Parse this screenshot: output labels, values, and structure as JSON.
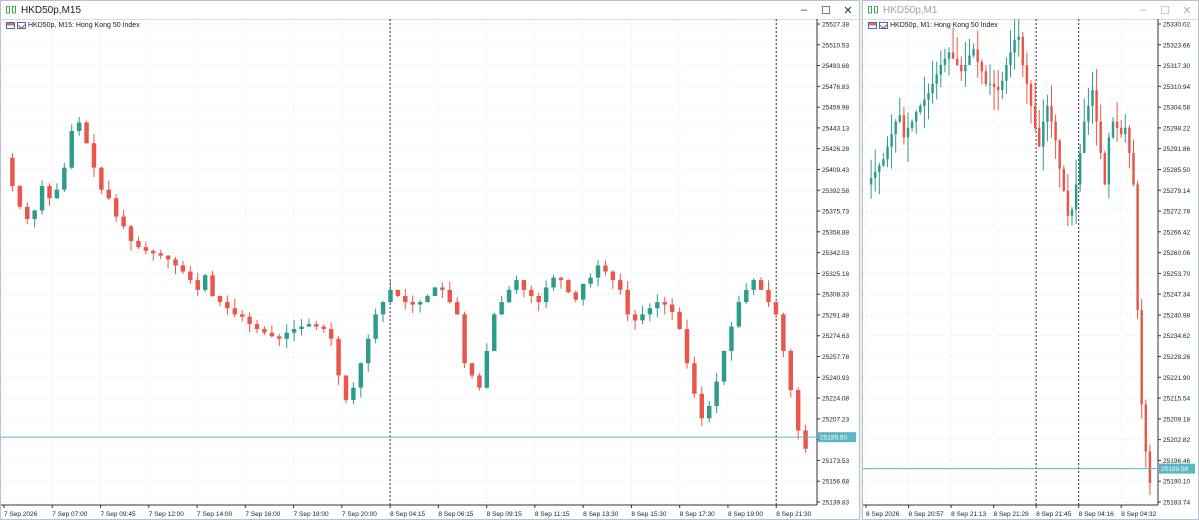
{
  "windows": [
    {
      "title": "HKD50p,M15",
      "legend": "HKD50p, M15:  Hong Kong 50 Index",
      "controls": {
        "minimize": "–",
        "maximize": "☐",
        "close": "✕"
      },
      "bid_label": "25189.50",
      "colors": {
        "bull": "#2e9c8c",
        "bear": "#e8574a",
        "bid_line": "#5bb7c4",
        "grid": "#dde3ea"
      }
    },
    {
      "title": "HKD50p,M1",
      "legend": "HKD50p, M1:  Hong Kong 50 Index",
      "controls": {
        "minimize": "–",
        "maximize": "☐",
        "close": "✕"
      },
      "bid_label": "25189.58",
      "colors": {
        "bull": "#2e9c8c",
        "bear": "#e8574a",
        "bid_line": "#5bb7c4",
        "grid": "#dde3ea"
      }
    }
  ],
  "chart_data": [
    {
      "type": "candlestick",
      "symbol": "HKD50p",
      "timeframe": "M15",
      "y_ticks": [
        "25527.38",
        "25510.53",
        "25493.68",
        "25476.83",
        "25459.98",
        "25443.13",
        "25426.28",
        "25409.43",
        "25392.58",
        "25375.73",
        "25358.88",
        "25342.03",
        "25325.18",
        "25308.33",
        "25291.48",
        "25274.63",
        "25257.78",
        "25240.93",
        "25224.08",
        "25207.23",
        "25190.38",
        "25173.53",
        "25156.68",
        "25139.83"
      ],
      "ylim": [
        25134,
        25530
      ],
      "x_ticks": [
        "7 Sep 2026",
        "7 Sep 07:00",
        "7 Sep 09:45",
        "7 Sep 12:00",
        "7 Sep 14:00",
        "7 Sep 16:00",
        "7 Sep 18:00",
        "7 Sep 20:00",
        "8 Sep 04:15",
        "8 Sep 06:15",
        "8 Sep 09:15",
        "8 Sep 11:15",
        "8 Sep 13:30",
        "8 Sep 15:30",
        "8 Sep 17:30",
        "8 Sep 19:00",
        "8 Sep 21:30"
      ],
      "close_path": [
        25418,
        25395,
        25378,
        25368,
        25375,
        25395,
        25385,
        25392,
        25410,
        25440,
        25447,
        25430,
        25410,
        25392,
        25385,
        25370,
        25362,
        25350,
        25345,
        25342,
        25340,
        25338,
        25335,
        25330,
        25325,
        25318,
        25310,
        25322,
        25305,
        25300,
        25295,
        25290,
        25288,
        25282,
        25278,
        25275,
        25272,
        25270,
        25275,
        25278,
        25280,
        25282,
        25280,
        25278,
        25270,
        25240,
        25220,
        25230,
        25250,
        25270,
        25290,
        25300,
        25310,
        25305,
        25300,
        25298,
        25300,
        25305,
        25312,
        25310,
        25300,
        25290,
        25250,
        25240,
        25230,
        25260,
        25290,
        25300,
        25310,
        25318,
        25310,
        25305,
        25300,
        25312,
        25320,
        25318,
        25308,
        25302,
        25315,
        25320,
        25330,
        25325,
        25318,
        25310,
        25290,
        25285,
        25290,
        25295,
        25300,
        25298,
        25292,
        25278,
        25250,
        25225,
        25205,
        25215,
        25235,
        25260,
        25280,
        25300,
        25310,
        25318,
        25310,
        25300,
        25290,
        25260,
        25228,
        25195,
        25180
      ],
      "bid": 25189.5,
      "period_separators_at": [
        "8 Sep 04:15",
        "8 Sep 21:30"
      ]
    },
    {
      "type": "candlestick",
      "symbol": "HKD50p",
      "timeframe": "M1",
      "y_ticks": [
        "25330.02",
        "25323.66",
        "25317.30",
        "25310.94",
        "25304.58",
        "25298.22",
        "25291.86",
        "25285.50",
        "25279.14",
        "25272.78",
        "25266.42",
        "25260.06",
        "25253.70",
        "25247.34",
        "25240.98",
        "25234.62",
        "25228.26",
        "25221.90",
        "25215.54",
        "25209.18",
        "25202.82",
        "25196.46",
        "25190.10",
        "25183.74"
      ],
      "ylim": [
        25178,
        25332
      ],
      "x_ticks": [
        "8 Sep 2026",
        "8 Sep 20:57",
        "8 Sep 21:13",
        "8 Sep 21:29",
        "8 Sep 21:45",
        "8 Sep 04:16",
        "8 Sep 04:32"
      ],
      "close_path": [
        25280,
        25282,
        25284,
        25286,
        25288,
        25292,
        25296,
        25300,
        25302,
        25295,
        25298,
        25300,
        25303,
        25305,
        25307,
        25309,
        25312,
        25315,
        25318,
        25320,
        25322,
        25320,
        25318,
        25316,
        25318,
        25321,
        25323,
        25319,
        25316,
        25312,
        25312,
        25311,
        25310,
        25313,
        25318,
        25322,
        25326,
        25327,
        25318,
        25312,
        25305,
        25298,
        25292,
        25300,
        25305,
        25300,
        25294,
        25285,
        25278,
        25270,
        25272,
        25280,
        25290,
        25300,
        25305,
        25310,
        25300,
        25290,
        25280,
        25295,
        25300,
        25298,
        25296,
        25298,
        25290,
        25280,
        25240,
        25210,
        25195,
        25185
      ],
      "bid": 25189.58,
      "period_separators_at": [
        "8 Sep 21:45",
        "8 Sep 04:16"
      ]
    }
  ]
}
